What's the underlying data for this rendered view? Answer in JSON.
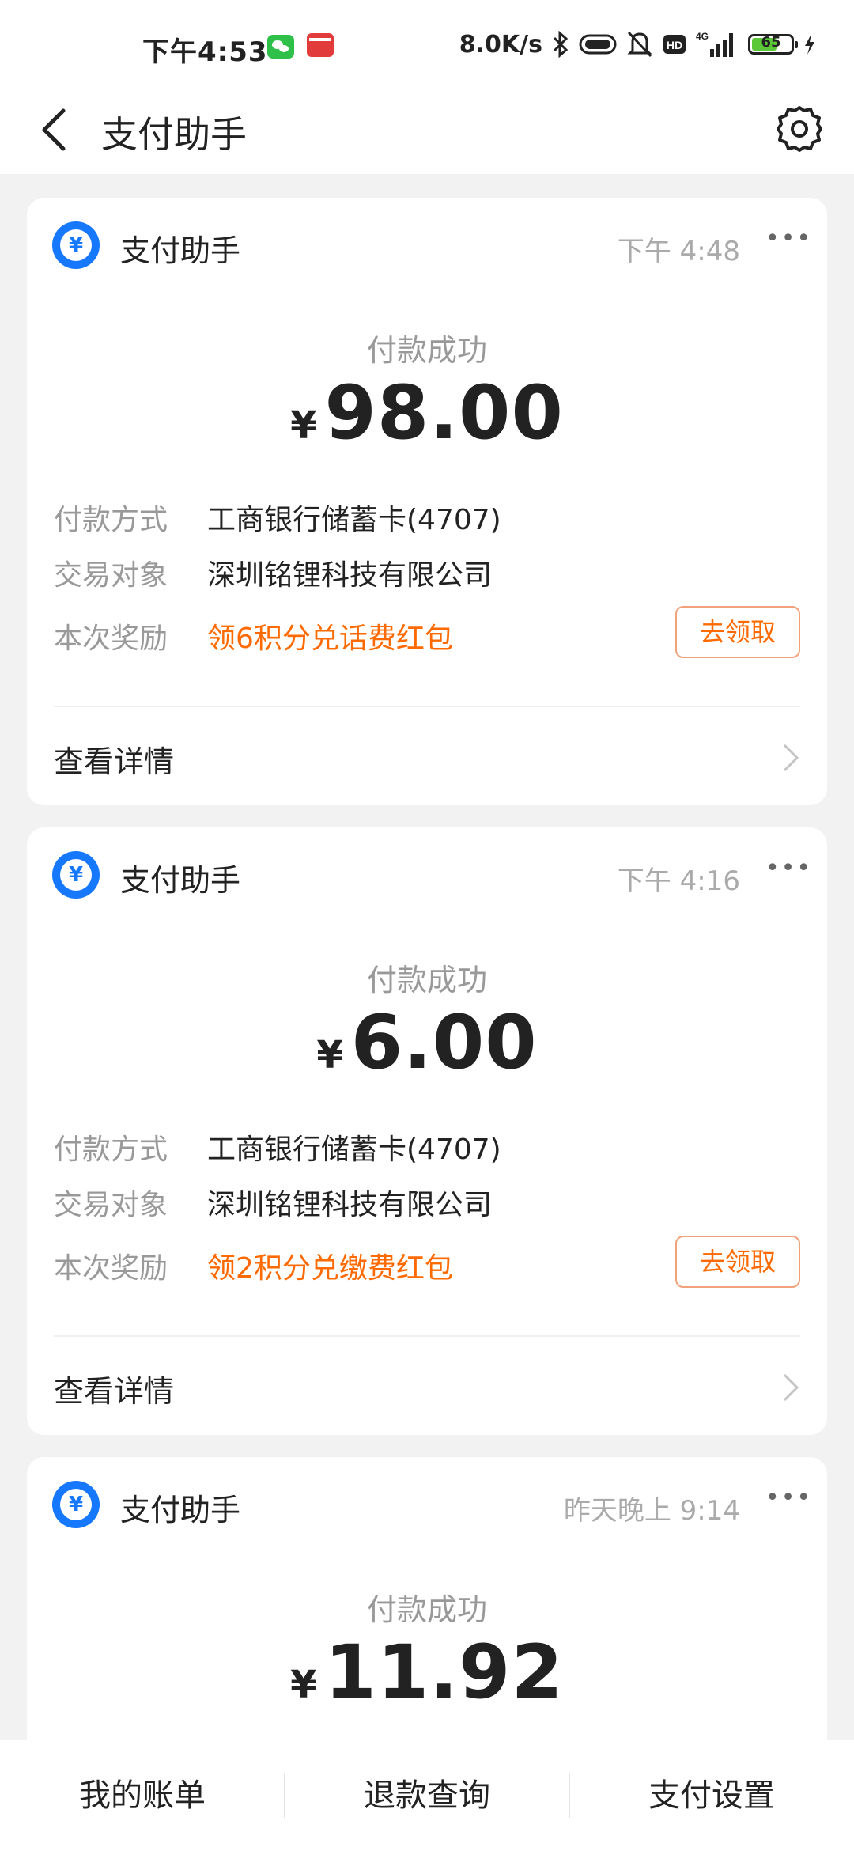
{
  "status_bar": {
    "time": "下午4:53",
    "net_speed": "8.0K/s",
    "network": "4G",
    "battery": "65",
    "battery_level": 0.65
  },
  "header": {
    "title": "支付助手"
  },
  "cards": [
    {
      "app_name": "支付助手",
      "time": "下午 4:48",
      "status": "付款成功",
      "currency": "¥",
      "amount": "98.00",
      "method_label": "付款方式",
      "method_value": "工商银行储蓄卡(4707)",
      "merchant_label": "交易对象",
      "merchant_value": "深圳铭锂科技有限公司",
      "reward_label": "本次奖励",
      "reward_value": "领6积分兑话费红包",
      "claim_label": "去领取",
      "detail_label": "查看详情"
    },
    {
      "app_name": "支付助手",
      "time": "下午 4:16",
      "status": "付款成功",
      "currency": "¥",
      "amount": "6.00",
      "method_label": "付款方式",
      "method_value": "工商银行储蓄卡(4707)",
      "merchant_label": "交易对象",
      "merchant_value": "深圳铭锂科技有限公司",
      "reward_label": "本次奖励",
      "reward_value": "领2积分兑缴费红包",
      "claim_label": "去领取",
      "detail_label": "查看详情"
    },
    {
      "app_name": "支付助手",
      "time": "昨天晚上 9:14",
      "status": "付款成功",
      "currency": "¥",
      "amount": "11.92"
    }
  ],
  "bottom_bar": {
    "items": [
      "我的账单",
      "退款查询",
      "支付设置"
    ]
  },
  "colors": {
    "accent_blue": "#1677ff",
    "reward_orange": "#ff6a00",
    "background": "#f2f2f2"
  }
}
